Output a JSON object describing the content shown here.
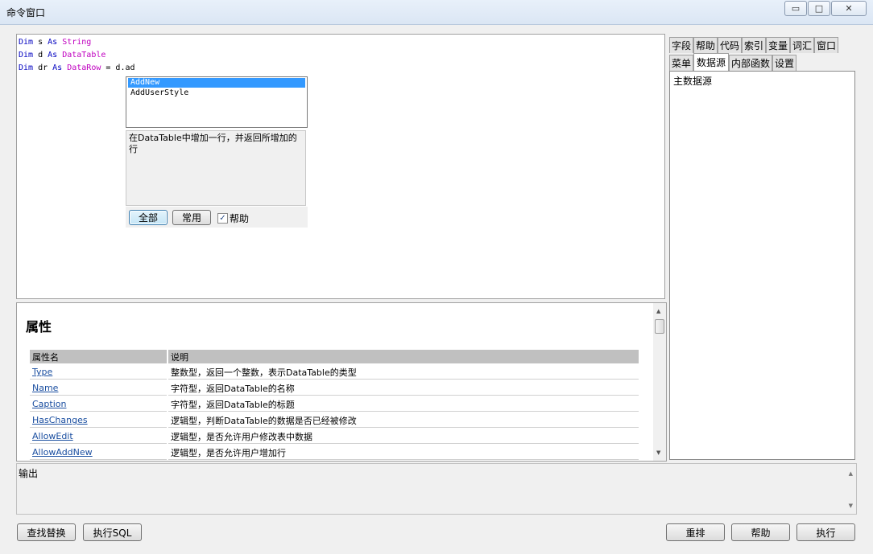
{
  "window": {
    "title": "命令窗口",
    "buttons": {
      "minimize": "▭",
      "maximize": "□",
      "close": "✕"
    }
  },
  "editor": {
    "lines": [
      {
        "kw1": "Dim",
        "name": " s ",
        "kw2": "As",
        "type": " String",
        "rest": ""
      },
      {
        "kw1": "Dim",
        "name": " d ",
        "kw2": "As",
        "type": " DataTable",
        "rest": ""
      },
      {
        "kw1": "Dim",
        "name": " dr ",
        "kw2": "As",
        "type": " DataRow",
        "rest": " = d.ad"
      }
    ]
  },
  "autocomplete": {
    "items": [
      "AddNew",
      "AddUserStyle"
    ],
    "selected_index": 0,
    "description": "在DataTable中增加一行，并返回所增加的行",
    "all_button": "全部",
    "common_button": "常用",
    "help_checkbox_label": "帮助",
    "help_checked": true
  },
  "help": {
    "heading": "属性",
    "columns": [
      "属性名",
      "说明"
    ],
    "rows": [
      {
        "name": "Type",
        "desc": "整数型，返回一个整数，表示DataTable的类型"
      },
      {
        "name": "Name",
        "desc": "字符型，返回DataTable的名称"
      },
      {
        "name": "Caption",
        "desc": "字符型，返回DataTable的标题"
      },
      {
        "name": "HasChanges",
        "desc": "逻辑型，判断DataTable的数据是否已经被修改"
      },
      {
        "name": "AllowEdit",
        "desc": "逻辑型，是否允许用户修改表中数据"
      },
      {
        "name": "AllowAddNew",
        "desc": "逻辑型，是否允许用户增加行"
      }
    ]
  },
  "right_panel": {
    "tabs_row1": [
      "字段",
      "帮助",
      "代码",
      "索引",
      "变量",
      "词汇",
      "窗口"
    ],
    "tabs_row2": [
      "菜单",
      "数据源",
      "内部函数",
      "设置"
    ],
    "active_tab": "数据源",
    "datasource_items": [
      "主数据源"
    ]
  },
  "output": {
    "label": "输出"
  },
  "footer": {
    "find_replace": "查找替换",
    "exec_sql": "执行SQL",
    "reorder": "重排",
    "help": "帮助",
    "execute": "执行"
  },
  "colors": {
    "keyword": "#0000c0",
    "type": "#c000c0",
    "selection": "#3399ff",
    "link": "#1a4ea0"
  }
}
